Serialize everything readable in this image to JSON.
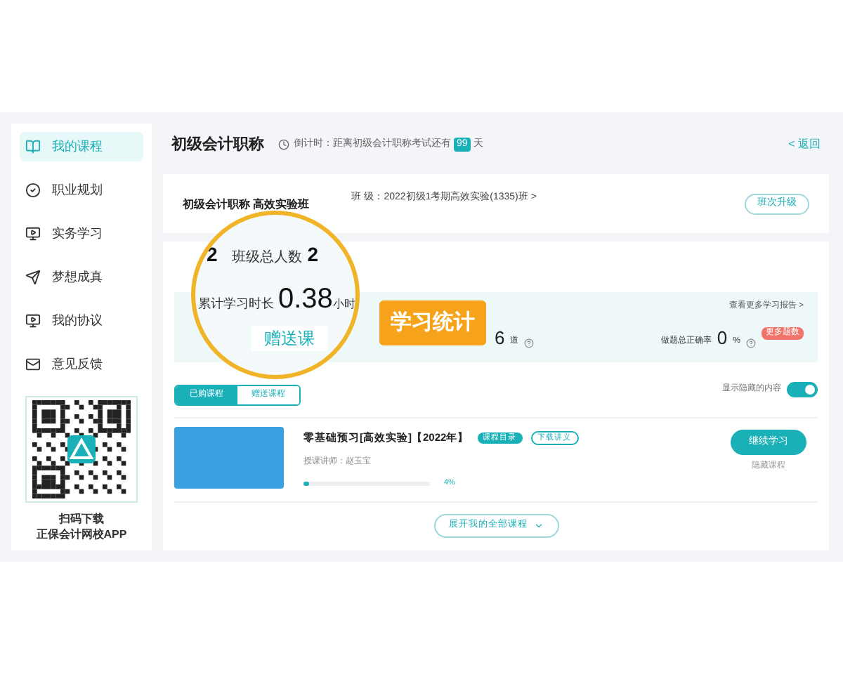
{
  "sidebar": {
    "items": [
      {
        "label": "我的课程",
        "selected": true
      },
      {
        "label": "职业规划",
        "selected": false
      },
      {
        "label": "实务学习",
        "selected": false
      },
      {
        "label": "梦想成真",
        "selected": false
      },
      {
        "label": "我的协议",
        "selected": false
      },
      {
        "label": "意见反馈",
        "selected": false
      }
    ],
    "qr_caption": [
      "扫码下载",
      "正保会计网校APP"
    ]
  },
  "header": {
    "title": "初级会计职称",
    "countdown_prefix": "倒计时：距离初级会计职称考试还有",
    "days": "99",
    "countdown_suffix": "天",
    "back_arrow": "<",
    "back": "返回"
  },
  "class_card": {
    "title": "初级会计职称 高效实验班",
    "class_label": "班 级：",
    "class_name": "2022初级1考期高效实验(1335)班 >",
    "upgrade": "班次升级"
  },
  "stats": {
    "report_link": "查看更多学习报告 >",
    "done_value": "6",
    "done_unit": "道",
    "accuracy_label": "做题总正确率",
    "accuracy_value": "0",
    "accuracy_unit": "%",
    "badge": "更多题数"
  },
  "tabs": [
    {
      "label": "已购课程",
      "selected": true
    },
    {
      "label": "赠送课程",
      "selected": false
    }
  ],
  "show_hidden": {
    "label": "显示隐藏的内容",
    "on": true
  },
  "courses": [
    {
      "title": "零基础预习[高效实验]【2022年】",
      "tags": [
        "课程目录",
        "下载讲义"
      ],
      "teacher": "授课讲师：赵玉宝",
      "level": 0.04,
      "reading": "4%",
      "primary": "继续学习",
      "secondary": "隐藏课程"
    }
  ],
  "expand": "展开我的全部课程",
  "magnifier": {
    "left_value": "2",
    "class_label": "班级总人数",
    "class_value": "2",
    "study_label": "累计学习时长",
    "study_value": "0.38",
    "study_unit": "小时",
    "tab_text": "赠送课"
  },
  "callout": "学习统计"
}
